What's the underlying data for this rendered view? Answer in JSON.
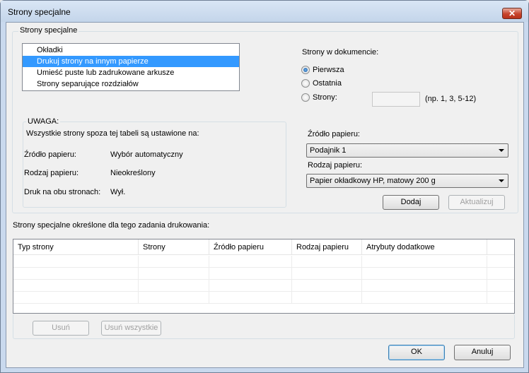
{
  "window": {
    "title": "Strony specjalne",
    "close_label": "✕"
  },
  "special_pages_group": {
    "legend": "Strony specjalne",
    "list_items": [
      "Okładki",
      "Drukuj strony na innym papierze",
      "Umieść puste lub zadrukowane arkusze",
      "Strony separujące rozdziałów"
    ],
    "selected_index": 1
  },
  "document_pages": {
    "label": "Strony w dokumencie:",
    "options": [
      "Pierwsza",
      "Ostatnia",
      "Strony:"
    ],
    "selected": "Pierwsza",
    "pages_input_value": "",
    "pages_hint": "(np. 1, 3, 5-12)"
  },
  "note": {
    "legend": "UWAGA:",
    "text": "Wszystkie strony spoza tej tabeli są ustawione na:",
    "rows": [
      {
        "label": "Źródło papieru:",
        "value": "Wybór automatyczny"
      },
      {
        "label": "Rodzaj papieru:",
        "value": "Nieokreślony"
      },
      {
        "label": "Druk na obu stronach:",
        "value": "Wył."
      }
    ]
  },
  "paper": {
    "source_label": "Źródło papieru:",
    "source_value": "Podajnik 1",
    "type_label": "Rodzaj papieru:",
    "type_value": "Papier okładkowy HP, matowy 200 g",
    "add_label": "Dodaj",
    "update_label": "Aktualizuj"
  },
  "job_table": {
    "caption": "Strony specjalne określone dla tego zadania drukowania:",
    "columns": [
      "Typ strony",
      "Strony",
      "Źródło papieru",
      "Rodzaj papieru",
      "Atrybuty dodatkowe"
    ],
    "rows": [],
    "remove_label": "Usuń",
    "remove_all_label": "Usuń wszystkie"
  },
  "footer": {
    "ok_label": "OK",
    "cancel_label": "Anuluj"
  }
}
